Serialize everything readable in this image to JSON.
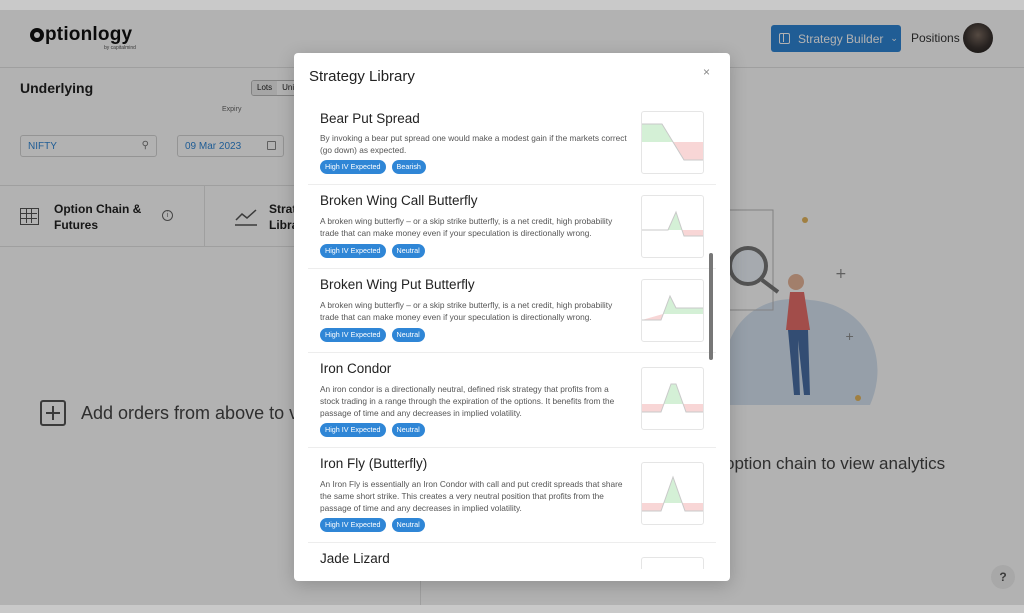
{
  "app": {
    "logo_text": "ptionlogy",
    "logo_sub": "by capitalmind",
    "strategy_button": "Strategy Builder",
    "positions_link": "Positions",
    "underlying": {
      "title": "Underlying",
      "toggle_left": "Lots",
      "toggle_right": "Uni",
      "expiry_label": "Expiry",
      "symbol_value": "NIFTY",
      "expiry_value": "09 Mar 2023"
    },
    "tabs": {
      "option_chain": "Option Chain & Futures",
      "strategy_line1": "Strat",
      "strategy_line2": "Libra"
    },
    "empty_left": "Add orders from above to v",
    "empty_right": "option chain to view analytics",
    "help": "?"
  },
  "modal": {
    "title": "Strategy Library",
    "close_label": "×",
    "items": [
      {
        "name": "Bear Put Spread",
        "description": "By invoking a bear put spread one would make a modest gain if the markets correct (go down) as expected.",
        "tags": [
          "High IV Expected",
          "Bearish"
        ]
      },
      {
        "name": "Broken Wing Call Butterfly",
        "description": "A broken wing butterfly – or a skip strike butterfly, is a net credit, high probability trade that can make money even if your speculation is directionally wrong.",
        "tags": [
          "High IV Expected",
          "Neutral"
        ]
      },
      {
        "name": "Broken Wing Put Butterfly",
        "description": "A broken wing butterfly – or a skip strike butterfly, is a net credit, high probability trade that can make money even if your speculation is directionally wrong.",
        "tags": [
          "High IV Expected",
          "Neutral"
        ]
      },
      {
        "name": "Iron Condor",
        "description": "An iron condor is a directionally neutral, defined risk strategy that profits from a stock trading in a range through the expiration of the options. It benefits from the passage of time and any decreases in implied volatility.",
        "tags": [
          "High IV Expected",
          "Neutral"
        ]
      },
      {
        "name": "Iron Fly (Butterfly)",
        "description": "An Iron Fly is essentially an Iron Condor with call and put credit spreads that share the same short strike. This creates a very neutral position that profits from the passage of time and any decreases in implied volatility.",
        "tags": [
          "High IV Expected",
          "Neutral"
        ]
      },
      {
        "name": "Jade Lizard",
        "description": "",
        "tags": []
      }
    ]
  },
  "colors": {
    "accent": "#2f86d6",
    "profit": "#d4f0d6",
    "loss": "#f8d6d6"
  }
}
